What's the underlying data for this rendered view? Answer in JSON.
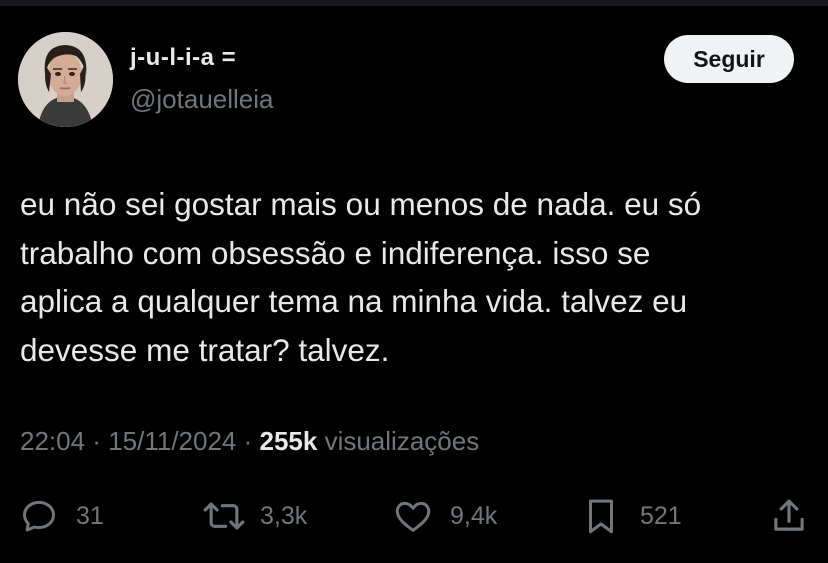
{
  "author": {
    "display_name": "j-u-l-i-a =",
    "handle": "@jotauelleia"
  },
  "follow_button": {
    "label": "Seguir"
  },
  "tweet": {
    "lines": [
      "eu não sei gostar mais ou menos de nada. eu só",
      "trabalho com obsessão e indiferença. isso se",
      "aplica a qualquer tema na minha vida. talvez eu",
      "devesse me tratar? talvez."
    ]
  },
  "meta": {
    "time": "22:04",
    "separator": " · ",
    "date": "15/11/2024",
    "views_count": "255k",
    "views_label": " visualizações"
  },
  "actions": {
    "replies": "31",
    "reposts": "3,3k",
    "likes": "9,4k",
    "bookmarks": "521"
  },
  "icons": {
    "reply": "reply-icon",
    "repost": "repost-icon",
    "like": "heart-icon",
    "bookmark": "bookmark-icon",
    "share": "share-icon"
  },
  "colors": {
    "background": "#000000",
    "text_primary": "#e7e9ea",
    "text_secondary": "#71767b",
    "button_bg": "#eff3f4"
  }
}
